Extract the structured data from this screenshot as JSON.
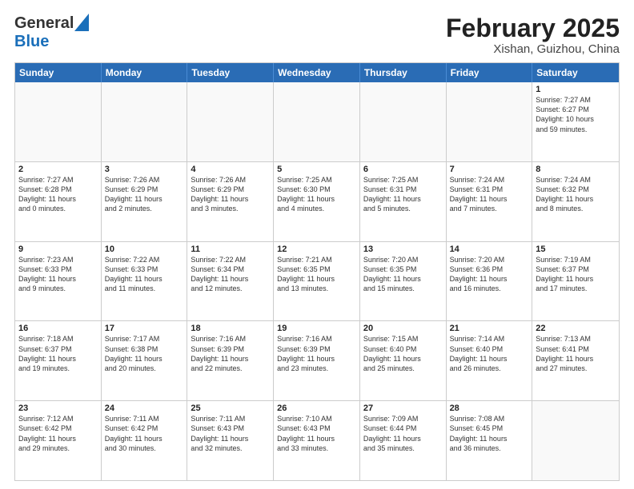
{
  "header": {
    "logo": {
      "line1": "General",
      "line2": "Blue"
    },
    "month_year": "February 2025",
    "location": "Xishan, Guizhou, China"
  },
  "days_of_week": [
    "Sunday",
    "Monday",
    "Tuesday",
    "Wednesday",
    "Thursday",
    "Friday",
    "Saturday"
  ],
  "weeks": [
    [
      {
        "day": "",
        "info": ""
      },
      {
        "day": "",
        "info": ""
      },
      {
        "day": "",
        "info": ""
      },
      {
        "day": "",
        "info": ""
      },
      {
        "day": "",
        "info": ""
      },
      {
        "day": "",
        "info": ""
      },
      {
        "day": "1",
        "info": "Sunrise: 7:27 AM\nSunset: 6:27 PM\nDaylight: 10 hours\nand 59 minutes."
      }
    ],
    [
      {
        "day": "2",
        "info": "Sunrise: 7:27 AM\nSunset: 6:28 PM\nDaylight: 11 hours\nand 0 minutes."
      },
      {
        "day": "3",
        "info": "Sunrise: 7:26 AM\nSunset: 6:29 PM\nDaylight: 11 hours\nand 2 minutes."
      },
      {
        "day": "4",
        "info": "Sunrise: 7:26 AM\nSunset: 6:29 PM\nDaylight: 11 hours\nand 3 minutes."
      },
      {
        "day": "5",
        "info": "Sunrise: 7:25 AM\nSunset: 6:30 PM\nDaylight: 11 hours\nand 4 minutes."
      },
      {
        "day": "6",
        "info": "Sunrise: 7:25 AM\nSunset: 6:31 PM\nDaylight: 11 hours\nand 5 minutes."
      },
      {
        "day": "7",
        "info": "Sunrise: 7:24 AM\nSunset: 6:31 PM\nDaylight: 11 hours\nand 7 minutes."
      },
      {
        "day": "8",
        "info": "Sunrise: 7:24 AM\nSunset: 6:32 PM\nDaylight: 11 hours\nand 8 minutes."
      }
    ],
    [
      {
        "day": "9",
        "info": "Sunrise: 7:23 AM\nSunset: 6:33 PM\nDaylight: 11 hours\nand 9 minutes."
      },
      {
        "day": "10",
        "info": "Sunrise: 7:22 AM\nSunset: 6:33 PM\nDaylight: 11 hours\nand 11 minutes."
      },
      {
        "day": "11",
        "info": "Sunrise: 7:22 AM\nSunset: 6:34 PM\nDaylight: 11 hours\nand 12 minutes."
      },
      {
        "day": "12",
        "info": "Sunrise: 7:21 AM\nSunset: 6:35 PM\nDaylight: 11 hours\nand 13 minutes."
      },
      {
        "day": "13",
        "info": "Sunrise: 7:20 AM\nSunset: 6:35 PM\nDaylight: 11 hours\nand 15 minutes."
      },
      {
        "day": "14",
        "info": "Sunrise: 7:20 AM\nSunset: 6:36 PM\nDaylight: 11 hours\nand 16 minutes."
      },
      {
        "day": "15",
        "info": "Sunrise: 7:19 AM\nSunset: 6:37 PM\nDaylight: 11 hours\nand 17 minutes."
      }
    ],
    [
      {
        "day": "16",
        "info": "Sunrise: 7:18 AM\nSunset: 6:37 PM\nDaylight: 11 hours\nand 19 minutes."
      },
      {
        "day": "17",
        "info": "Sunrise: 7:17 AM\nSunset: 6:38 PM\nDaylight: 11 hours\nand 20 minutes."
      },
      {
        "day": "18",
        "info": "Sunrise: 7:16 AM\nSunset: 6:39 PM\nDaylight: 11 hours\nand 22 minutes."
      },
      {
        "day": "19",
        "info": "Sunrise: 7:16 AM\nSunset: 6:39 PM\nDaylight: 11 hours\nand 23 minutes."
      },
      {
        "day": "20",
        "info": "Sunrise: 7:15 AM\nSunset: 6:40 PM\nDaylight: 11 hours\nand 25 minutes."
      },
      {
        "day": "21",
        "info": "Sunrise: 7:14 AM\nSunset: 6:40 PM\nDaylight: 11 hours\nand 26 minutes."
      },
      {
        "day": "22",
        "info": "Sunrise: 7:13 AM\nSunset: 6:41 PM\nDaylight: 11 hours\nand 27 minutes."
      }
    ],
    [
      {
        "day": "23",
        "info": "Sunrise: 7:12 AM\nSunset: 6:42 PM\nDaylight: 11 hours\nand 29 minutes."
      },
      {
        "day": "24",
        "info": "Sunrise: 7:11 AM\nSunset: 6:42 PM\nDaylight: 11 hours\nand 30 minutes."
      },
      {
        "day": "25",
        "info": "Sunrise: 7:11 AM\nSunset: 6:43 PM\nDaylight: 11 hours\nand 32 minutes."
      },
      {
        "day": "26",
        "info": "Sunrise: 7:10 AM\nSunset: 6:43 PM\nDaylight: 11 hours\nand 33 minutes."
      },
      {
        "day": "27",
        "info": "Sunrise: 7:09 AM\nSunset: 6:44 PM\nDaylight: 11 hours\nand 35 minutes."
      },
      {
        "day": "28",
        "info": "Sunrise: 7:08 AM\nSunset: 6:45 PM\nDaylight: 11 hours\nand 36 minutes."
      },
      {
        "day": "",
        "info": ""
      }
    ]
  ]
}
